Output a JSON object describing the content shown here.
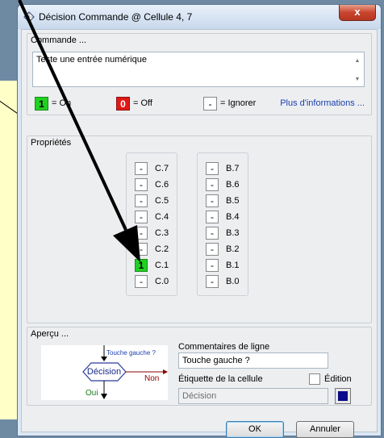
{
  "window": {
    "title": "Décision Commande @ Cellule 4, 7",
    "close_label": "x"
  },
  "commande": {
    "label": "Commande ...",
    "text": "Teste une entrée numérique"
  },
  "legend": {
    "on_value": "1",
    "on_label": "= On",
    "off_value": "0",
    "off_label": "= Off",
    "ignore_value": "-",
    "ignore_label": "= Ignorer",
    "more_info": "Plus d'informations ..."
  },
  "proprietes": {
    "label": "Propriétés",
    "port_c": [
      {
        "label": "C.7",
        "value": "-"
      },
      {
        "label": "C.6",
        "value": "-"
      },
      {
        "label": "C.5",
        "value": "-"
      },
      {
        "label": "C.4",
        "value": "-"
      },
      {
        "label": "C.3",
        "value": "-"
      },
      {
        "label": "C.2",
        "value": "-"
      },
      {
        "label": "C.1",
        "value": "1"
      },
      {
        "label": "C.0",
        "value": "-"
      }
    ],
    "port_b": [
      {
        "label": "B.7",
        "value": "-"
      },
      {
        "label": "B.6",
        "value": "-"
      },
      {
        "label": "B.5",
        "value": "-"
      },
      {
        "label": "B.4",
        "value": "-"
      },
      {
        "label": "B.3",
        "value": "-"
      },
      {
        "label": "B.2",
        "value": "-"
      },
      {
        "label": "B.1",
        "value": "-"
      },
      {
        "label": "B.0",
        "value": "-"
      }
    ]
  },
  "apercu": {
    "label": "Aperçu ...",
    "preview": {
      "comment": "Touche gauche ?",
      "shape_label": "Décision",
      "no_label": "Non",
      "yes_label": "Oui"
    },
    "comments_label": "Commentaires de ligne",
    "comments_value": "Touche gauche ?",
    "cell_label": "Étiquette de la cellule",
    "edition_label": "Édition",
    "cell_value": "Décision",
    "cell_color": "#0a0a8a"
  },
  "buttons": {
    "ok": "OK",
    "cancel": "Annuler"
  },
  "colors": {
    "on": "#22d022",
    "off": "#e01818",
    "link": "#1b3fb0"
  }
}
